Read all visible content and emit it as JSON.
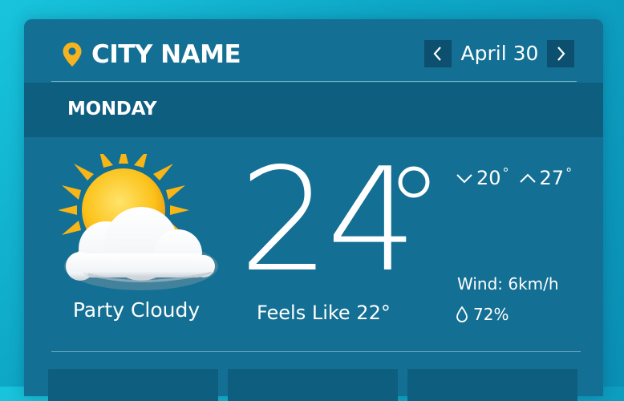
{
  "header": {
    "city": "CITY NAME",
    "date": "April 30"
  },
  "day": "MONDAY",
  "current": {
    "temperature": "24",
    "condition": "Party Cloudy",
    "feels_like": "Feels Like 22°",
    "min_temp": "20",
    "max_temp": "27",
    "wind": "Wind: 6km/h",
    "humidity": "72%"
  },
  "icons": {
    "location": "location-pin-icon",
    "prev": "chevron-left-icon",
    "next": "chevron-right-icon",
    "weather": "partly-cloudy-icon",
    "min": "chevron-down-icon",
    "max": "chevron-up-icon",
    "humidity": "water-drop-icon"
  },
  "colors": {
    "background": "#15b8d6",
    "card": "#136f93",
    "day_band": "#0e5e80",
    "nav_button": "#0c4f6e",
    "pin": "#f5b321"
  },
  "forecast_tiles": [
    {},
    {},
    {}
  ]
}
